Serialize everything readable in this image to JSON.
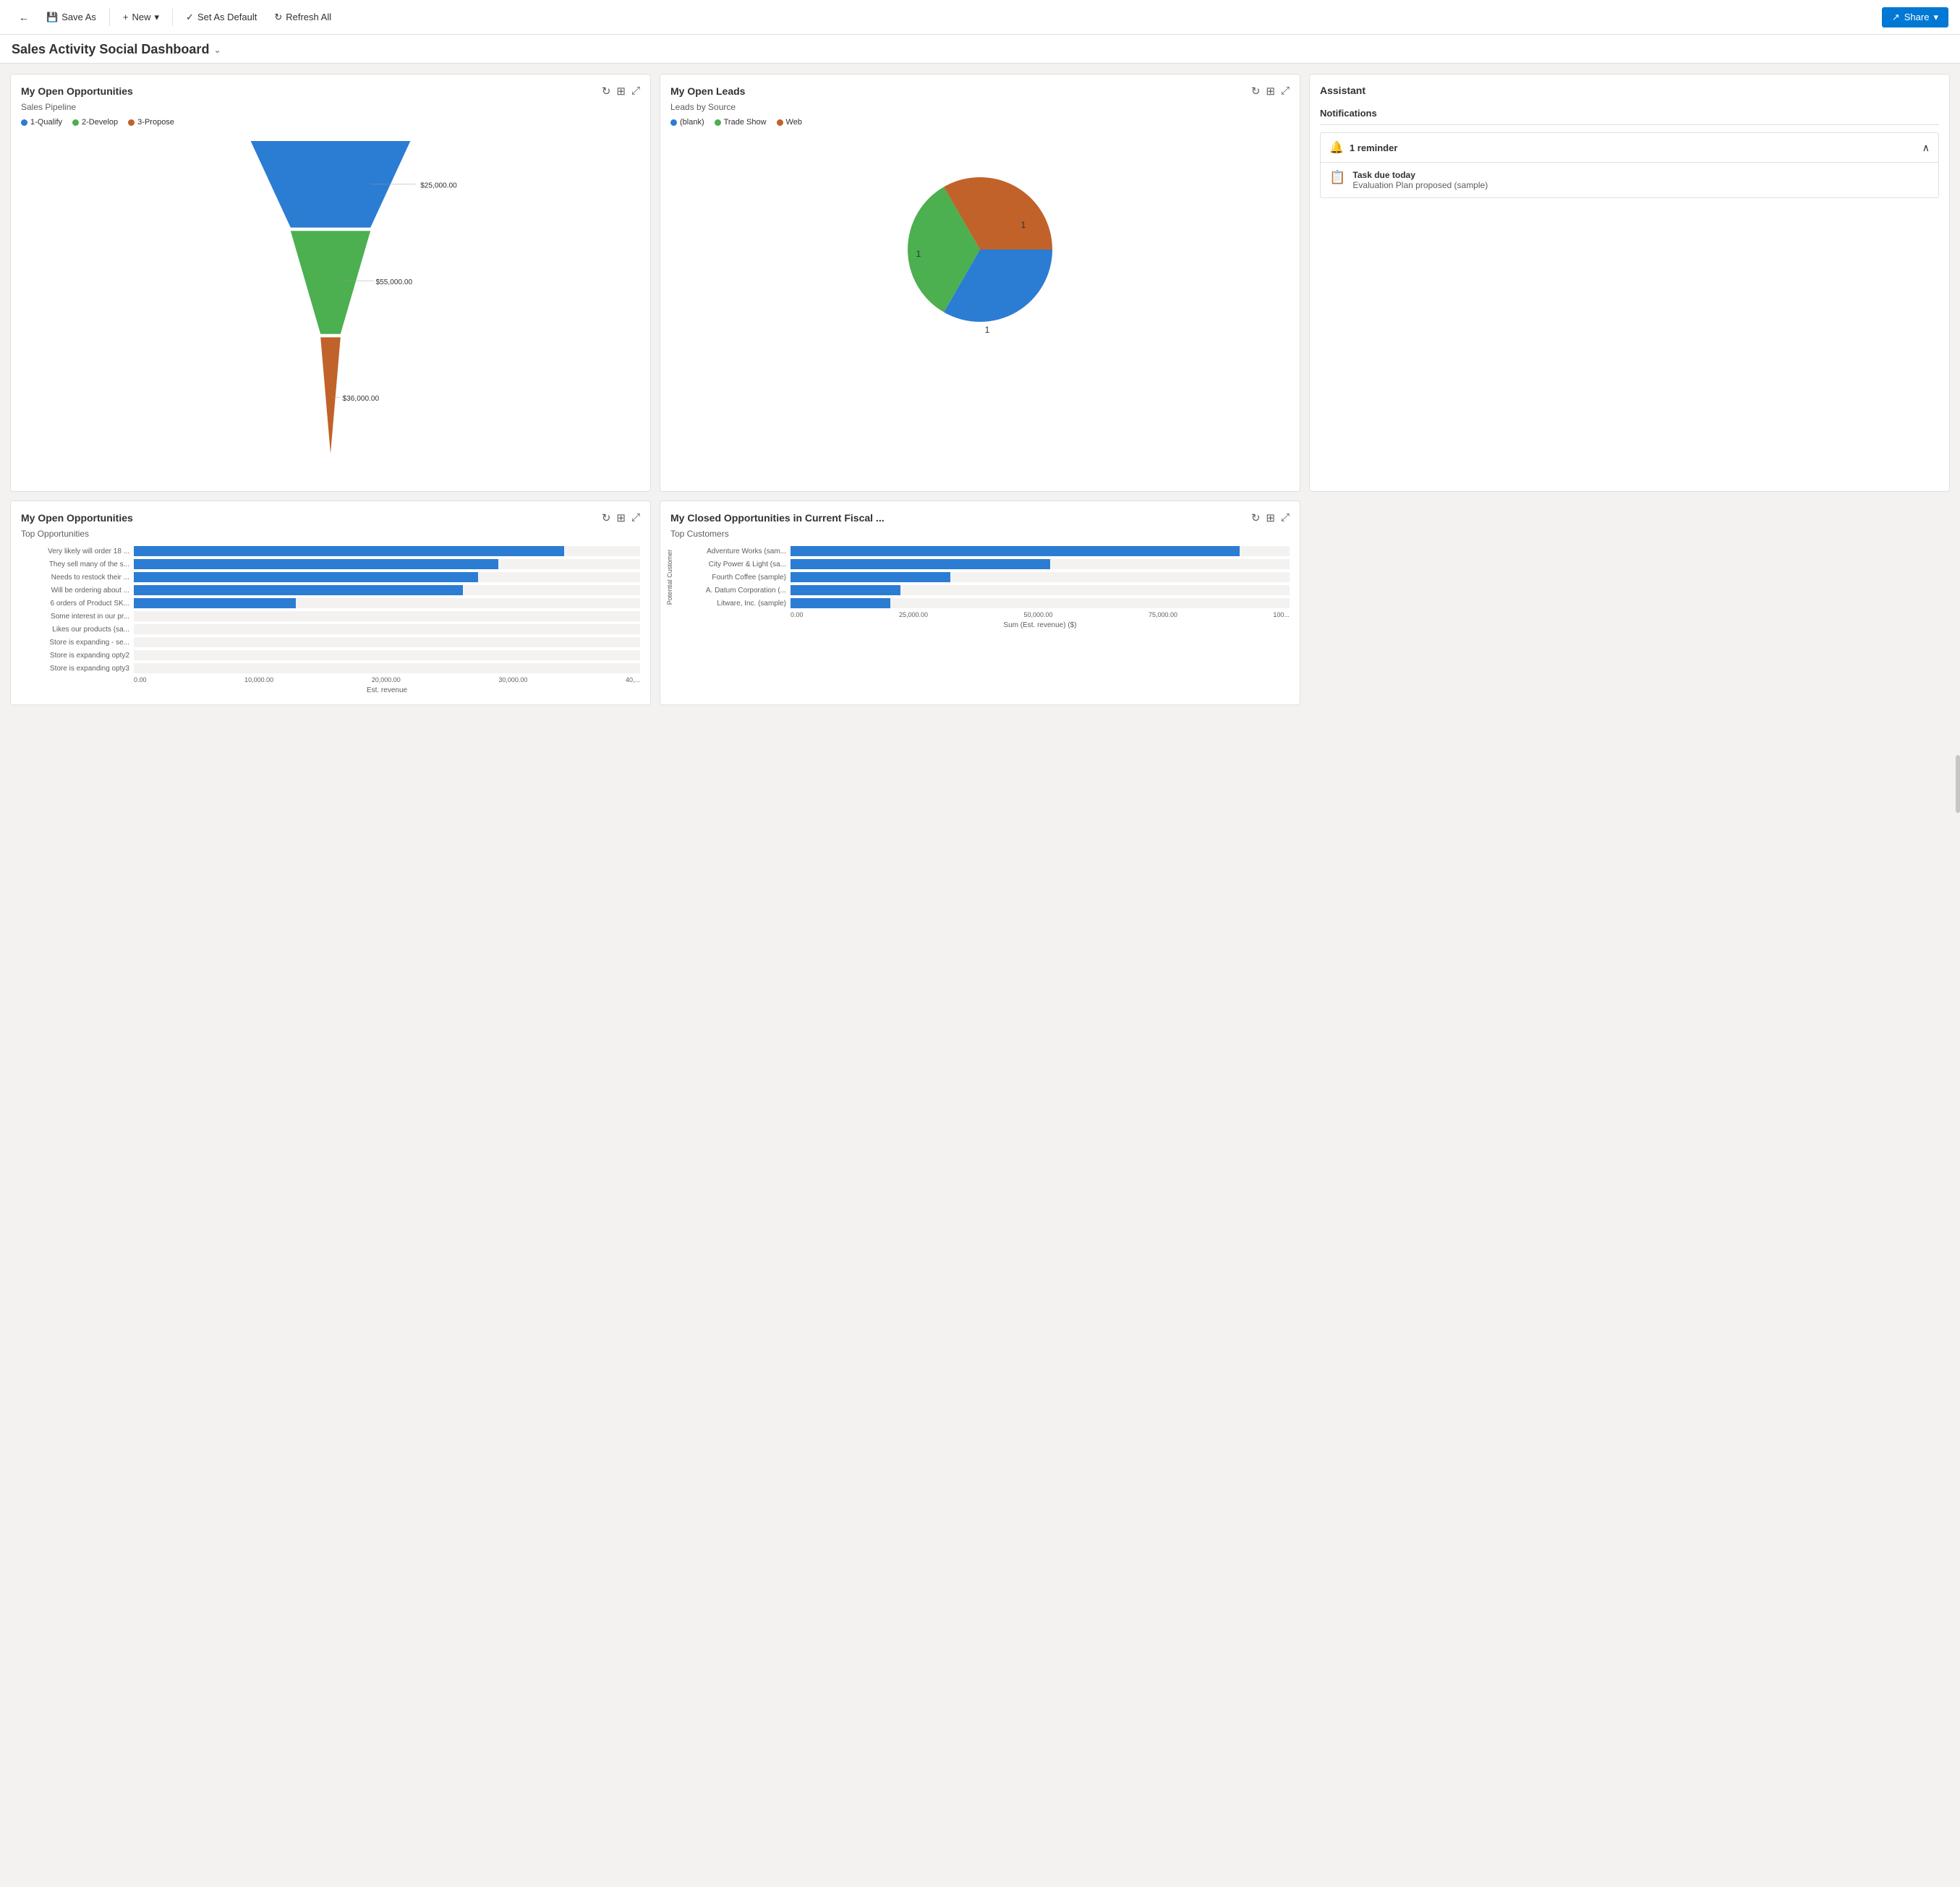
{
  "topbar": {
    "back_icon": "←",
    "save_as_label": "Save As",
    "new_label": "New",
    "set_default_label": "Set As Default",
    "refresh_label": "Refresh All",
    "share_label": "Share"
  },
  "page_title": "Sales Activity Social Dashboard",
  "cards": {
    "open_opportunities": {
      "title": "My Open Opportunities",
      "subtitle": "Sales Pipeline",
      "legend": [
        {
          "label": "1-Qualify",
          "color": "#2b7cd3"
        },
        {
          "label": "2-Develop",
          "color": "#4caf50"
        },
        {
          "label": "3-Propose",
          "color": "#c0622a"
        }
      ],
      "funnel": [
        {
          "label": "$25,000.00",
          "color": "#2b7cd3",
          "width": 100,
          "height": 110
        },
        {
          "label": "$55,000.00",
          "color": "#4caf50",
          "width": 76,
          "height": 160
        },
        {
          "label": "$36,000.00",
          "color": "#c0622a",
          "width": 44,
          "height": 140
        }
      ]
    },
    "open_leads": {
      "title": "My Open Leads",
      "subtitle": "Leads by Source",
      "legend": [
        {
          "label": "(blank)",
          "color": "#2b7cd3"
        },
        {
          "label": "Trade Show",
          "color": "#4caf50"
        },
        {
          "label": "Web",
          "color": "#c0622a"
        }
      ],
      "pie_segments": [
        {
          "label": "blank",
          "value": 1,
          "color": "#2b7cd3",
          "startAngle": 0,
          "endAngle": 120
        },
        {
          "label": "Trade Show",
          "value": 1,
          "color": "#4caf50",
          "startAngle": 120,
          "endAngle": 240
        },
        {
          "label": "Web",
          "value": 1,
          "color": "#c0622a",
          "startAngle": 240,
          "endAngle": 360
        }
      ]
    },
    "assistant": {
      "title": "Assistant",
      "notifications_label": "Notifications",
      "reminder_count": "1 reminder",
      "items": [
        {
          "icon": "📋",
          "title": "Task due today",
          "body": "Evaluation Plan proposed (sample)"
        }
      ]
    },
    "top_opportunities": {
      "title": "My Open Opportunities",
      "subtitle": "Top Opportunities",
      "axis_label": "Est. revenue",
      "axis_ticks": [
        "0.00",
        "10,000.00",
        "20,000.00",
        "30,000.00",
        "40,..."
      ],
      "bars": [
        {
          "label": "Very likely will order 18 ...",
          "value": 85
        },
        {
          "label": "They sell many of the s...",
          "value": 72
        },
        {
          "label": "Needs to restock their ...",
          "value": 68
        },
        {
          "label": "Will be ordering about ...",
          "value": 65
        },
        {
          "label": "6 orders of Product SK...",
          "value": 32
        },
        {
          "label": "Some interest in our pr...",
          "value": 0
        },
        {
          "label": "Likes our products (sa...",
          "value": 0
        },
        {
          "label": "Store is expanding - se...",
          "value": 0
        },
        {
          "label": "Store is expanding opty2",
          "value": 0
        },
        {
          "label": "Store is expanding opty3",
          "value": 0
        }
      ]
    },
    "closed_opportunities": {
      "title": "My Closed Opportunities in Current Fiscal ...",
      "subtitle": "Top Customers",
      "axis_label": "Sum (Est. revenue) ($)",
      "y_axis_label": "Potential Customer",
      "axis_ticks": [
        "0.00",
        "25,000.00",
        "50,000.00",
        "75,000.00",
        "100..."
      ],
      "bars": [
        {
          "label": "Adventure Works (sam...",
          "value": 90
        },
        {
          "label": "City Power & Light (sa...",
          "value": 52
        },
        {
          "label": "Fourth Coffee (sample)",
          "value": 32
        },
        {
          "label": "A. Datum Corporation (...",
          "value": 22
        },
        {
          "label": "Litware, Inc. (sample)",
          "value": 20
        }
      ]
    }
  }
}
